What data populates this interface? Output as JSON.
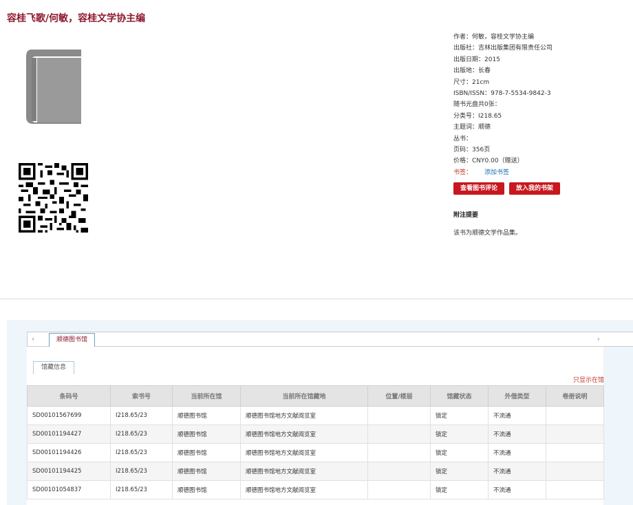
{
  "book": {
    "title_line": "容桂飞歌/何敏，容桂文学协主编"
  },
  "meta": {
    "rows": [
      {
        "label": "作者：",
        "value": "何敏，容桂文学协主编"
      },
      {
        "label": "出版社：",
        "value": "吉林出版集团有限责任公司"
      },
      {
        "label": "出版日期：",
        "value": "2015"
      },
      {
        "label": "出版地：",
        "value": "长春"
      },
      {
        "label": "尺寸：",
        "value": "21cm"
      },
      {
        "label": "ISBN/ISSN：",
        "value": "978-7-5534-9842-3"
      },
      {
        "label": "随书光盘共0张：",
        "value": ""
      },
      {
        "label": "分类号：",
        "value": "I218.65"
      },
      {
        "label": "主题词：",
        "value": "顺德"
      },
      {
        "label": "丛书：",
        "value": ""
      },
      {
        "label": "页码：",
        "value": "356页"
      },
      {
        "label": "价格：",
        "value": "CNY0.00（赠送）"
      }
    ],
    "tag_label": "书签：",
    "tag_link": "添加书签",
    "btn_review": "查看图书评论",
    "btn_shelf": "放入我的书架",
    "summary_title": "附注提要",
    "summary_text": "该书为顺德文学作品集。"
  },
  "holdings": {
    "library_tab": "顺德图书馆",
    "sub_tab": "馆藏信息",
    "only_link": "只显示在馆",
    "columns": [
      "条码号",
      "索书号",
      "当前所在馆",
      "当前所在馆藏地",
      "位置/楼层",
      "馆藏状态",
      "外借类型",
      "卷册说明"
    ],
    "rows": [
      [
        "SD00101567699",
        "I218.65/23",
        "顺德图书馆",
        "顺德图书馆地方文献阅览室",
        "",
        "锁定",
        "不流通",
        ""
      ],
      [
        "SD00101194427",
        "I218.65/23",
        "顺德图书馆",
        "顺德图书馆地方文献阅览室",
        "",
        "锁定",
        "不流通",
        ""
      ],
      [
        "SD00101194426",
        "I218.65/23",
        "顺德图书馆",
        "顺德图书馆地方文献阅览室",
        "",
        "锁定",
        "不流通",
        ""
      ],
      [
        "SD00101194425",
        "I218.65/23",
        "顺德图书馆",
        "顺德图书馆地方文献阅览室",
        "",
        "锁定",
        "不流通",
        ""
      ],
      [
        "SD00101054837",
        "I218.65/23",
        "顺德图书馆",
        "顺德图书馆地方文献阅览室",
        "",
        "锁定",
        "不流通",
        ""
      ]
    ]
  },
  "colors": {
    "title": "#8e1a2e",
    "button": "#c8171e",
    "link": "#1a6fb0",
    "panel_bg": "#eef5fb"
  }
}
